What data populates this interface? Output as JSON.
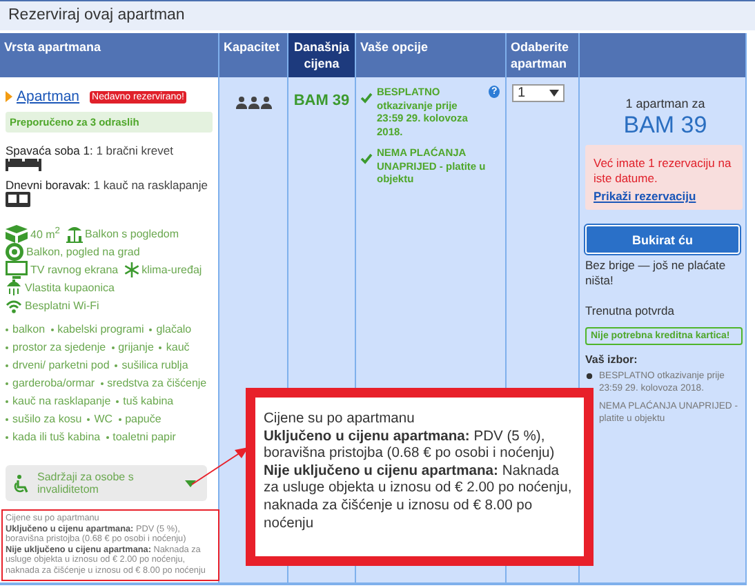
{
  "section_title": "Rezerviraj ovaj apartman",
  "columns": [
    {
      "label": "Vrsta apartmana",
      "highlighted": false
    },
    {
      "label": "Kapacitet",
      "highlighted": false
    },
    {
      "label": "Današnja cijena",
      "highlighted": true
    },
    {
      "label": "Vaše opcije",
      "highlighted": false
    },
    {
      "label": "Odaberite apartman",
      "highlighted": false
    }
  ],
  "room": {
    "name": "Apartman",
    "badge": "Nedavno rezervirano!",
    "recommendation": "Preporučeno za 3 odraslih",
    "beds": [
      {
        "kind": "double-bed",
        "label": "Spavaća soba 1:",
        "value": "1 bračni krevet"
      },
      {
        "kind": "sofa",
        "label": "Dnevni boravak:",
        "value": "1 kauč na rasklapanje"
      }
    ],
    "feature_rows": [
      [
        {
          "kind": "area",
          "text": "40 m$^{2}$"
        },
        {
          "kind": "balcony",
          "text": "Balkon s pogledom"
        }
      ],
      [
        {
          "kind": "view",
          "text": "Balkon, pogled na grad"
        }
      ],
      [
        {
          "kind": "tv",
          "text": "TV ravnog ekrana"
        },
        {
          "kind": "ac",
          "text": "klima-uređaj"
        }
      ],
      [
        {
          "kind": "bath",
          "text": "Vlastita kupaonica"
        }
      ],
      [
        {
          "kind": "wifi",
          "text": "Besplatni Wi-Fi"
        }
      ]
    ],
    "amenity_rows": [
      [
        "balkon",
        "kabelski programi",
        "glačalo"
      ],
      [
        "prostor za sjedenje",
        "grijanje",
        "kauč"
      ],
      [
        "drveni/ parketni pod",
        "sušilica rublja"
      ],
      [
        "garderoba/ormar",
        "sredstva za čišćenje"
      ],
      [
        "kauč na rasklapanje",
        "tuš kabina"
      ],
      [
        "sušilo za kosu",
        "WC",
        "papuče"
      ],
      [
        "kada ili tuš kabina",
        "toaletni papir"
      ]
    ],
    "accessibility": "Sadržaji za osobe s invaliditetom",
    "price_note": [
      "Cijene su po apartmanu",
      "**Uključeno u cijenu apartmana:** PDV (5 %), boravišna pristojba (0.68 € po osobi i noćenju)",
      "**Nije uključeno u cijenu apartmana:** Naknada za usluge objekta u iznosu od € 2.00 po noćenju, naknada za čišćenje u iznosu od € 8.00 po noćenju"
    ]
  },
  "price": "BAM 39",
  "options": [
    {
      "text": "BESPLATNO otkazivanje prije 23:59 29. kolovoza 2018.",
      "help": "?"
    },
    {
      "text": "NEMA PLAĆANJA UNAPRIJED - platite u objektu"
    }
  ],
  "quantity": "1",
  "summary": {
    "caption": "1 apartman za",
    "total": "BAM 39",
    "alert": {
      "text": "Već imate 1 rezervaciju na iste datume.",
      "link": "Prikaži rezervaciju"
    },
    "button": "Bukirat ću",
    "reassurance": "Bez brige — još ne plaćate ništa!",
    "confirmation": "Trenutna potvrda",
    "no_card": "Nije potrebna kreditna kartica!",
    "choice_title": "Vaš izbor:",
    "choices": [
      {
        "text": "BESPLATNO otkazivanje prije 23:59 29. kolovoza 2018.",
        "bulleted": true
      },
      {
        "text": "NEMA PLAĆANJA UNAPRIJED - platite u objektu"
      }
    ]
  },
  "callout": [
    "Cijene su po apartmanu",
    "**Uključeno u cijenu apartmana:** PDV (5 %), boravišna pristojba (0.68 € po osobi i noćenju)",
    "**Nije uključeno u cijenu apartmana:** Naknada za usluge objekta u iznosu od € 2.00 po noćenju, naknada za čišćenje u iznosu od € 8.00 po noćenju"
  ]
}
